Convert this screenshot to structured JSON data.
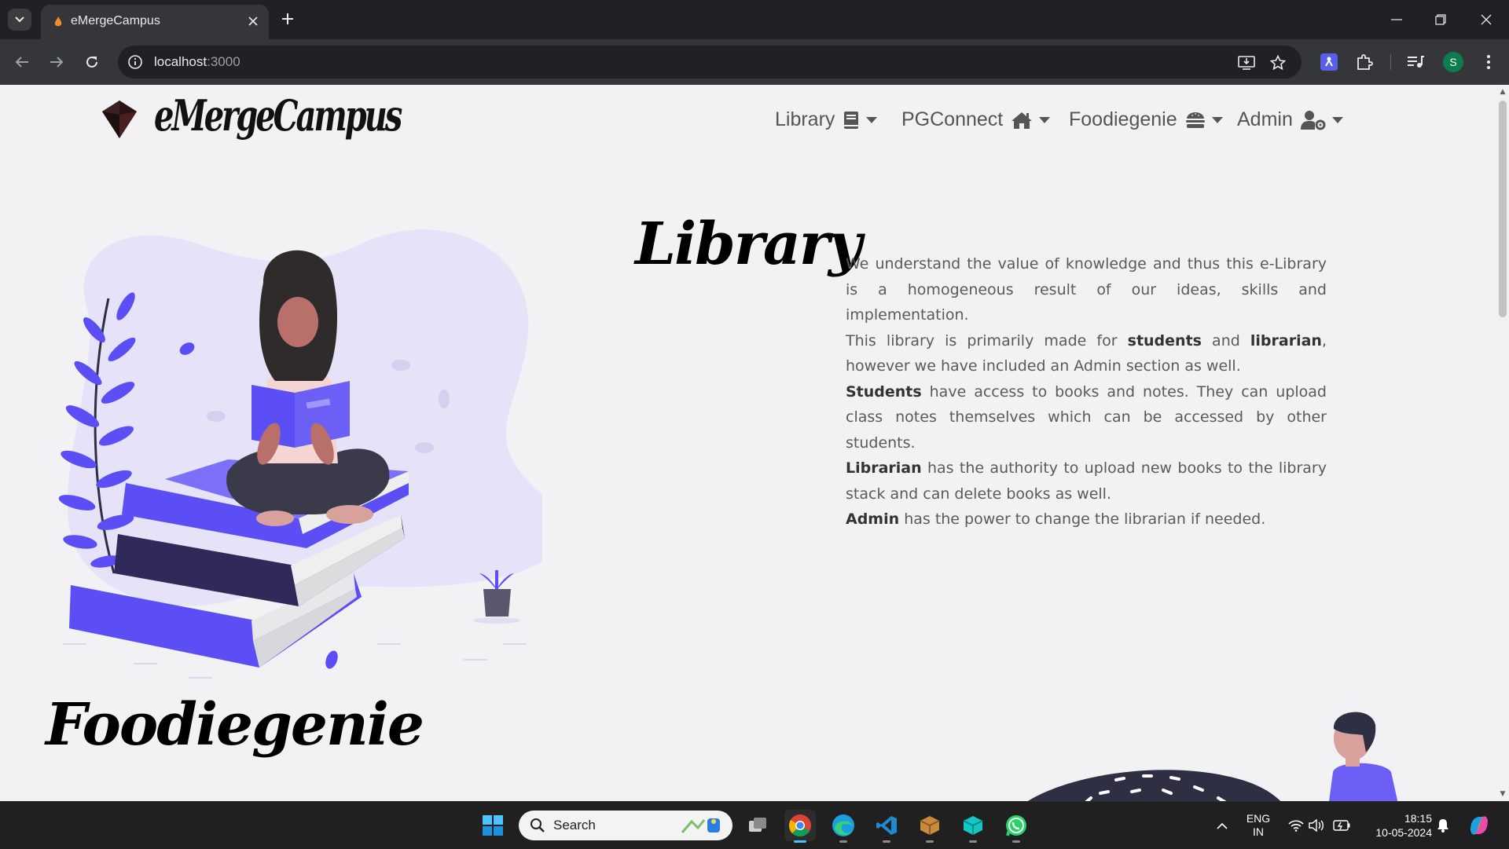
{
  "browser": {
    "tab_title": "eMergeCampus",
    "url_host": "localhost",
    "url_port": ":3000"
  },
  "site": {
    "brand": "eMergeCampus",
    "nav": [
      {
        "label": "Library",
        "icon": "book-icon"
      },
      {
        "label": "PGConnect",
        "icon": "home-icon"
      },
      {
        "label": "Foodiegenie",
        "icon": "burger-icon"
      },
      {
        "label": "Admin",
        "icon": "user-gear-icon"
      }
    ]
  },
  "library": {
    "title": "Library",
    "p1": "We understand the value of knowledge and thus this e-Library is a homogeneous result of our ideas, skills and implementation.",
    "p2_a": "This library is primarily made for ",
    "p2_b": "students",
    "p2_c": " and ",
    "p2_d": "librarian",
    "p2_e": ", however we have included an Admin section as well.",
    "p3_a": "Students",
    "p3_b": " have access to books and notes. They can upload class notes themselves which can be accessed by other students.",
    "p4_a": "Librarian",
    "p4_b": " has the authority to upload new books to the library stack and can delete books as well.",
    "p5_a": "Admin",
    "p5_b": " has the power to change the librarian if needed."
  },
  "foodiegenie": {
    "title": "Foodiegenie"
  },
  "taskbar": {
    "search_label": "Search",
    "lang_line1": "ENG",
    "lang_line2": "IN",
    "time": "18:15",
    "date": "10-05-2024"
  },
  "colors": {
    "accent": "#5b4ef5",
    "page_bg": "#f2f1f4",
    "chrome_dark": "#202124",
    "chrome_toolbar": "#35363a"
  }
}
